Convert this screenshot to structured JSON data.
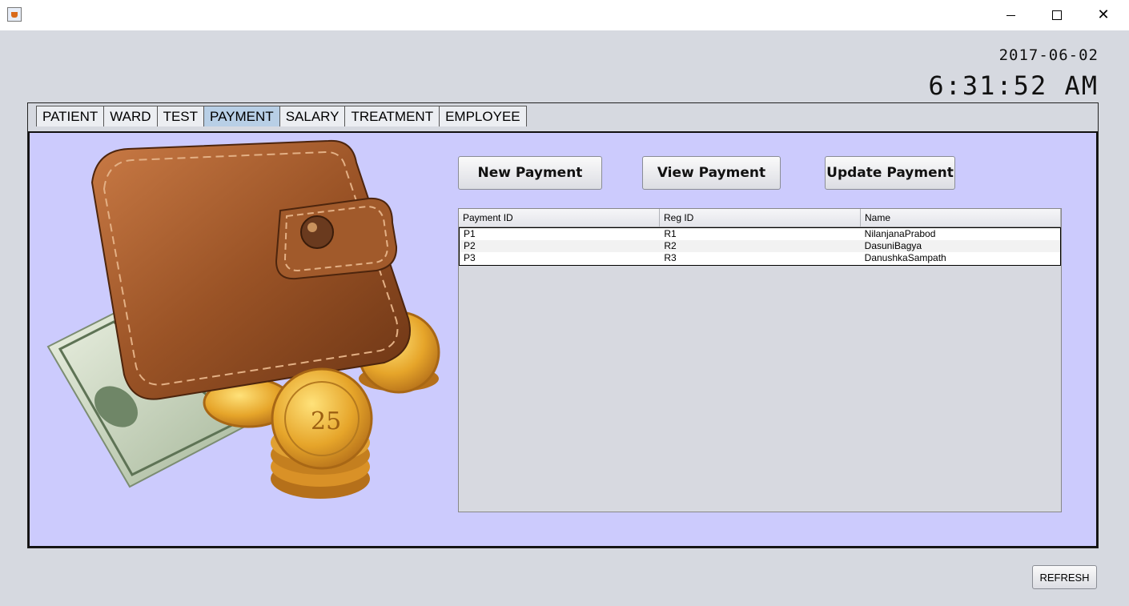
{
  "datetime": {
    "date": "2017-06-02",
    "time": "6:31:52 AM"
  },
  "tabs": [
    {
      "label": "PATIENT"
    },
    {
      "label": "WARD"
    },
    {
      "label": "TEST"
    },
    {
      "label": "PAYMENT",
      "active": true
    },
    {
      "label": "SALARY"
    },
    {
      "label": "TREATMENT"
    },
    {
      "label": "EMPLOYEE"
    }
  ],
  "actions": {
    "new_payment": "New Payment",
    "view_payment": "View Payment",
    "update_payment": "Update Payment"
  },
  "table": {
    "columns": [
      "Payment ID",
      "Reg ID",
      "Name"
    ],
    "rows": [
      [
        "P1",
        "R1",
        "NilanjanaPrabod"
      ],
      [
        "P2",
        "R2",
        "DasuniBagya"
      ],
      [
        "P3",
        "R3",
        "DanushkaSampath"
      ]
    ]
  },
  "footer": {
    "refresh_label": "REFRESH"
  },
  "colors": {
    "panel_bg": "#cccbfd",
    "active_tab": "#b8cfe6",
    "window_bg": "#d6d9e0"
  }
}
